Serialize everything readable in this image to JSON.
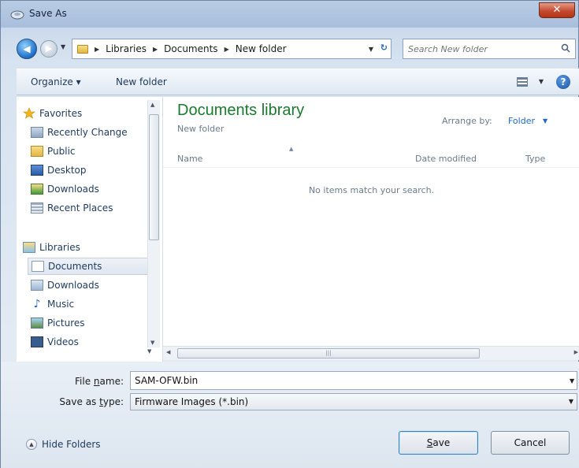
{
  "window": {
    "title": "Save As",
    "close_glyph": "✕"
  },
  "nav": {
    "back_glyph": "◀",
    "forward_glyph": "▶",
    "breadcrumb": [
      "Libraries",
      "Documents",
      "New folder"
    ],
    "search_placeholder": "Search New folder"
  },
  "toolbar": {
    "organize_label": "Organize ▾",
    "new_folder_label": "New folder",
    "help_glyph": "?"
  },
  "sidebar": {
    "favorites_header": "Favorites",
    "favorites": [
      "Recently Change",
      "Public",
      "Desktop",
      "Downloads",
      "Recent Places"
    ],
    "libraries_header": "Libraries",
    "libraries": [
      "Documents",
      "Downloads",
      "Music",
      "Pictures",
      "Videos"
    ],
    "selected": "Documents"
  },
  "content": {
    "title": "Documents library",
    "subtitle": "New folder",
    "arrange_by_label": "Arrange by:",
    "arrange_by_value": "Folder",
    "columns": {
      "name": "Name",
      "date_modified": "Date modified",
      "type": "Type"
    },
    "empty_message": "No items match your search."
  },
  "form": {
    "file_name_label_pre": "File ",
    "file_name_label_u": "n",
    "file_name_label_post": "ame:",
    "file_name_value": "SAM-OFW.bin",
    "save_as_type_label_pre": "Save as ",
    "save_as_type_label_u": "t",
    "save_as_type_label_post": "ype:",
    "save_as_type_value": "Firmware Images (*.bin)"
  },
  "footer": {
    "hide_folders_label": "Hide Folders",
    "save_label_u": "S",
    "save_label_post": "ave",
    "cancel_label": "Cancel"
  },
  "colors": {
    "library_title": "#1a7a2d",
    "link_blue": "#1e66c7",
    "close_red": "#c44a31"
  }
}
